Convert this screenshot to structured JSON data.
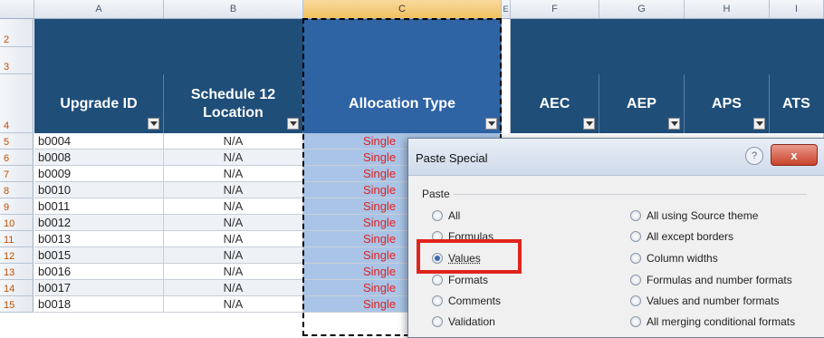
{
  "sheet": {
    "columns": [
      "A",
      "B",
      "C",
      "E",
      "F",
      "G",
      "H",
      "I"
    ],
    "selected_column": "C",
    "header_row_numbers": [
      "2",
      "3",
      "4"
    ],
    "headers": {
      "upgrade_id": "Upgrade ID",
      "schedule": "Schedule 12\nLocation",
      "allocation": "Allocation Type",
      "aec": "AEC",
      "aep": "AEP",
      "aps": "APS",
      "ats": "ATS"
    },
    "rows": [
      {
        "num": "5",
        "id": "b0004",
        "loc": "N/A",
        "alloc": "Single"
      },
      {
        "num": "6",
        "id": "b0008",
        "loc": "N/A",
        "alloc": "Single"
      },
      {
        "num": "7",
        "id": "b0009",
        "loc": "N/A",
        "alloc": "Single"
      },
      {
        "num": "8",
        "id": "b0010",
        "loc": "N/A",
        "alloc": "Single"
      },
      {
        "num": "9",
        "id": "b0011",
        "loc": "N/A",
        "alloc": "Single"
      },
      {
        "num": "10",
        "id": "b0012",
        "loc": "N/A",
        "alloc": "Single"
      },
      {
        "num": "11",
        "id": "b0013",
        "loc": "N/A",
        "alloc": "Single"
      },
      {
        "num": "12",
        "id": "b0015",
        "loc": "N/A",
        "alloc": "Single"
      },
      {
        "num": "13",
        "id": "b0016",
        "loc": "N/A",
        "alloc": "Single"
      },
      {
        "num": "14",
        "id": "b0017",
        "loc": "N/A",
        "alloc": "Single"
      },
      {
        "num": "15",
        "id": "b0018",
        "loc": "N/A",
        "alloc": "Single"
      }
    ],
    "colors": {
      "header_band": "#1f4e79",
      "selected_header": "#2e63a4",
      "selected_cell": "#a9c4e6",
      "alloc_text": "#e02020"
    }
  },
  "dialog": {
    "title": "Paste Special",
    "help": "?",
    "close": "x",
    "paste_group": "Paste",
    "left_options": [
      "All",
      "Formulas",
      "Values",
      "Formats",
      "Comments",
      "Validation"
    ],
    "right_options": [
      "All using Source theme",
      "All except borders",
      "Column widths",
      "Formulas and number formats",
      "Values and number formats",
      "All merging conditional formats"
    ],
    "selected_option": "Values",
    "highlight_color": "#e0241b"
  }
}
